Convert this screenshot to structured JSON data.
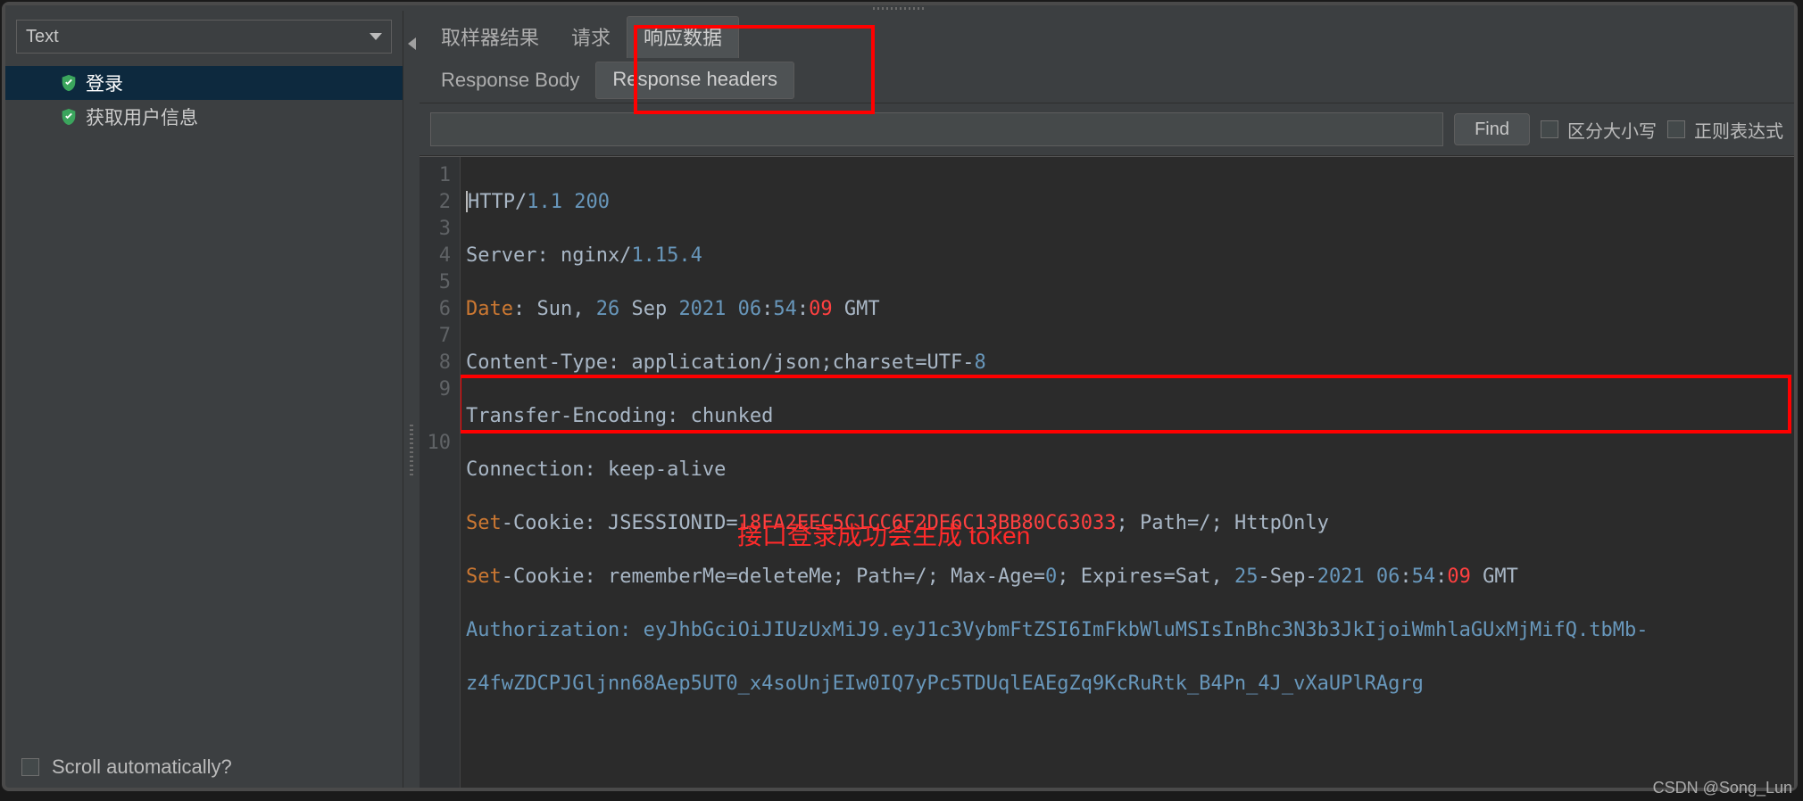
{
  "dropdown": {
    "value": "Text"
  },
  "tree": {
    "items": [
      {
        "label": "登录",
        "selected": true
      },
      {
        "label": "获取用户信息",
        "selected": false
      }
    ]
  },
  "leftFooter": {
    "label": "Scroll automatically?"
  },
  "tabs": {
    "row1": [
      {
        "label": "取样器结果"
      },
      {
        "label": "请求"
      },
      {
        "label": "响应数据",
        "active": true
      }
    ],
    "row2": [
      {
        "label": "Response Body"
      },
      {
        "label": "Response headers",
        "active": true
      }
    ]
  },
  "search": {
    "findLabel": "Find",
    "caseLabel": "区分大小写",
    "regexLabel": "正则表达式"
  },
  "code": {
    "lineNumbers": [
      "1",
      "2",
      "3",
      "4",
      "5",
      "6",
      "7",
      "8",
      "9",
      "",
      "10"
    ],
    "line1": {
      "a": "HTTP/",
      "b": "1.1 200"
    },
    "line2": {
      "a": "Server: nginx/",
      "b": "1.15.4"
    },
    "line3": {
      "a": "Date",
      "b": ": Sun, ",
      "c": "26",
      "d": " Sep ",
      "e": "2021 06",
      "f": ":",
      "g": "54",
      "h": ":",
      "i": "09",
      "j": " GMT"
    },
    "line4": {
      "a": "Content-Type: application/json;charset=UTF-",
      "b": "8"
    },
    "line5": "Transfer-Encoding: chunked",
    "line6": "Connection: keep-alive",
    "line7": {
      "a": "Set",
      "b": "-Cookie: JSESSIONID=",
      "c": "18FA2EEC5C1CC6F2DE6C13BB80C63033",
      "d": "; Path=/; HttpOnly"
    },
    "line8": {
      "a": "Set",
      "b": "-Cookie: rememberMe=deleteMe; Path=/; Max-Age=",
      "c": "0",
      "d": "; Expires=Sat, ",
      "e": "25",
      "f": "-Sep-",
      "g": "2021 06",
      "h": ":",
      "i": "54",
      "j": ":",
      "k": "09",
      "l": " GMT"
    },
    "line9a": "Authorization: eyJhbGciOiJIUzUxMiJ9.eyJ1c3VybmFtZSI6ImFkbWluMSIsInBhc3N3b3JkIjoiWmhlaGUxMjMifQ.tbMb-",
    "line9b": "z4fwZDCPJGljnn68Aep5UT0_x4soUnjEIw0IQ7yPc5TDUqlEAEgZq9KcRuRtk_B4Pn_4J_vXaUPlRAgrg"
  },
  "annotation": "接口登录成功会生成 token",
  "watermark": "CSDN @Song_Lun"
}
